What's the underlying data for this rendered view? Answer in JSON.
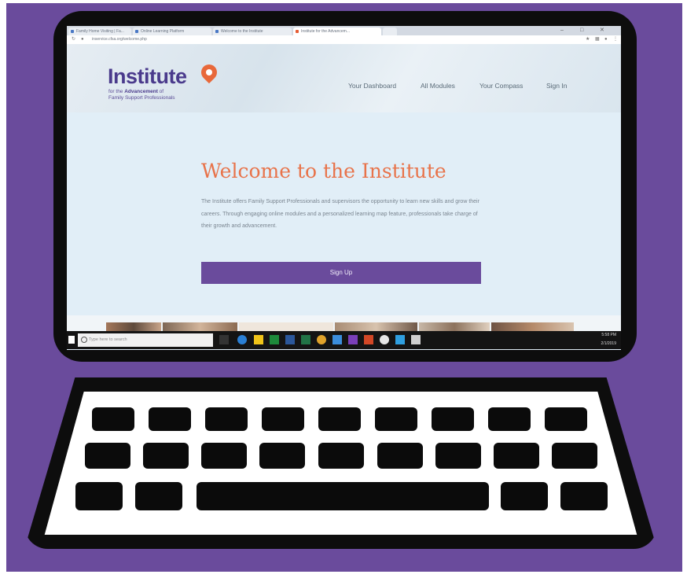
{
  "browser": {
    "tabs": [
      {
        "label": "Family Home Visiting | Fa..."
      },
      {
        "label": "Online Learning Platform"
      },
      {
        "label": "Welcome to the Institute"
      },
      {
        "label": "Institute for the Advancem..."
      }
    ],
    "address": "inservice.cfsa.org/welcome.php"
  },
  "site": {
    "logo": {
      "name": "Institute",
      "line1_pre": "for the ",
      "line1_em": "Advancement",
      "line1_post": " of",
      "line2": "Family Support Professionals"
    },
    "nav": [
      "Your Dashboard",
      "All Modules",
      "Your Compass",
      "Sign In"
    ],
    "hero": {
      "title": "Welcome to the Institute",
      "description": "The Institute offers Family Support Professionals and supervisors the opportunity to learn new skills and grow their careers. Through engaging online modules and a personalized learning map feature, professionals take charge of their growth and advancement.",
      "cta": "Sign Up"
    }
  },
  "taskbar": {
    "search_placeholder": "Type here to search",
    "time": "5:58 PM",
    "date": "2/1/2019"
  },
  "colors": {
    "background": "#6a4b9c",
    "laptop": "#0d0d0d",
    "accent": "#e8734a",
    "brand": "#4a3a8c",
    "button": "#6a4b9c"
  }
}
